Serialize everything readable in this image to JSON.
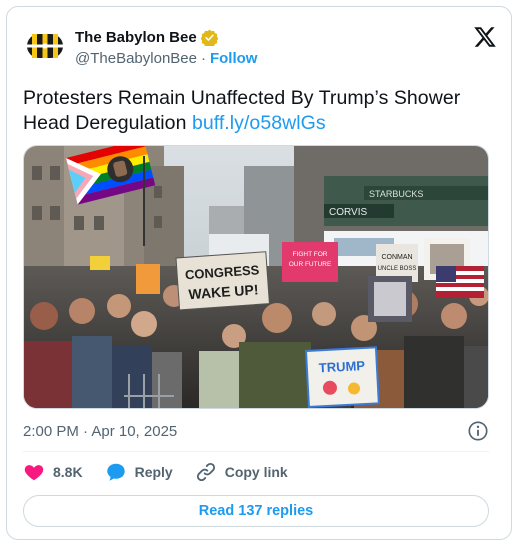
{
  "author": {
    "display_name": "The Babylon Bee",
    "handle": "@TheBabylonBee",
    "separator": "·",
    "follow_label": "Follow"
  },
  "tweet": {
    "text": "Protesters Remain Unaffected By Trump’s Shower Head Deregulation ",
    "link": "buff.ly/o58wlGs"
  },
  "media": {
    "signs": {
      "congress": "CONGRESS WAKE UP!",
      "trump": "TRUMP",
      "conman": "CONMAN UNCLE BOSS",
      "pink": "FIGHT FOR OUR FUTURE",
      "store": "STARBUCKS",
      "street": "CORVIS"
    }
  },
  "meta": {
    "timestamp": "2:00 PM · Apr 10, 2025"
  },
  "actions": {
    "likes": "8.8K",
    "reply": "Reply",
    "copy_link": "Copy link"
  },
  "read_replies": "Read 137 replies",
  "colors": {
    "accent": "#1d9bf0",
    "like": "#f91880",
    "verified": "#e2b719",
    "text": "#0f1419",
    "muted": "#536471"
  }
}
